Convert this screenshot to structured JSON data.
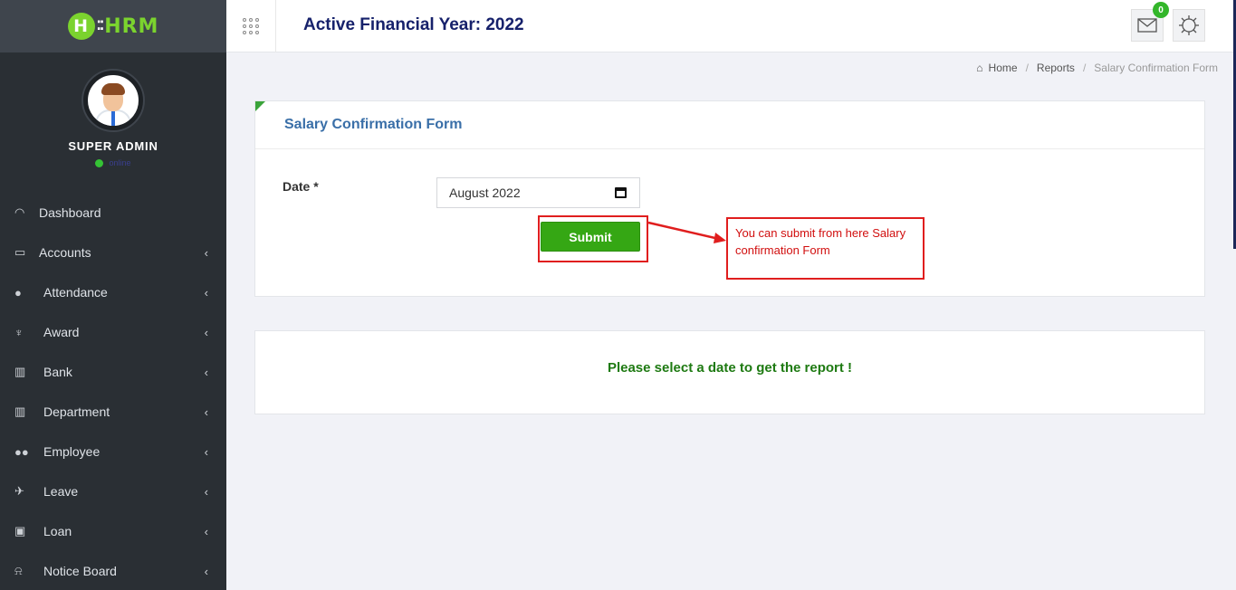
{
  "sidebar": {
    "logo": {
      "letter": "H",
      "text": "HRM"
    },
    "user": {
      "name": "SUPER ADMIN",
      "status": "online"
    },
    "items": [
      {
        "label": "Dashboard",
        "icon": "dashboard-icon"
      },
      {
        "label": "Accounts",
        "icon": "briefcase-icon"
      },
      {
        "label": "Attendance",
        "icon": "user-icon"
      },
      {
        "label": "Award",
        "icon": "trophy-icon"
      },
      {
        "label": "Bank",
        "icon": "bank-icon"
      },
      {
        "label": "Department",
        "icon": "bank-icon"
      },
      {
        "label": "Employee",
        "icon": "users-icon"
      },
      {
        "label": "Leave",
        "icon": "plane-icon"
      },
      {
        "label": "Loan",
        "icon": "money-icon"
      },
      {
        "label": "Notice Board",
        "icon": "bell-icon"
      }
    ]
  },
  "header": {
    "title": "Active Financial Year: 2022",
    "mail_count": "0"
  },
  "breadcrumb": {
    "home": "Home",
    "reports": "Reports",
    "current": "Salary Confirmation Form"
  },
  "form": {
    "title": "Salary Confirmation Form",
    "date_label": "Date *",
    "date_value": "August  2022",
    "submit_label": "Submit",
    "annotation": "You can submit from here Salary confirmation Form"
  },
  "report": {
    "message": "Please select a date to get the report !"
  },
  "colors": {
    "sidebar_bg": "#2a2f34",
    "accent_green": "#35a714",
    "title_navy": "#16216b",
    "annotation_red": "#e01e1e"
  }
}
